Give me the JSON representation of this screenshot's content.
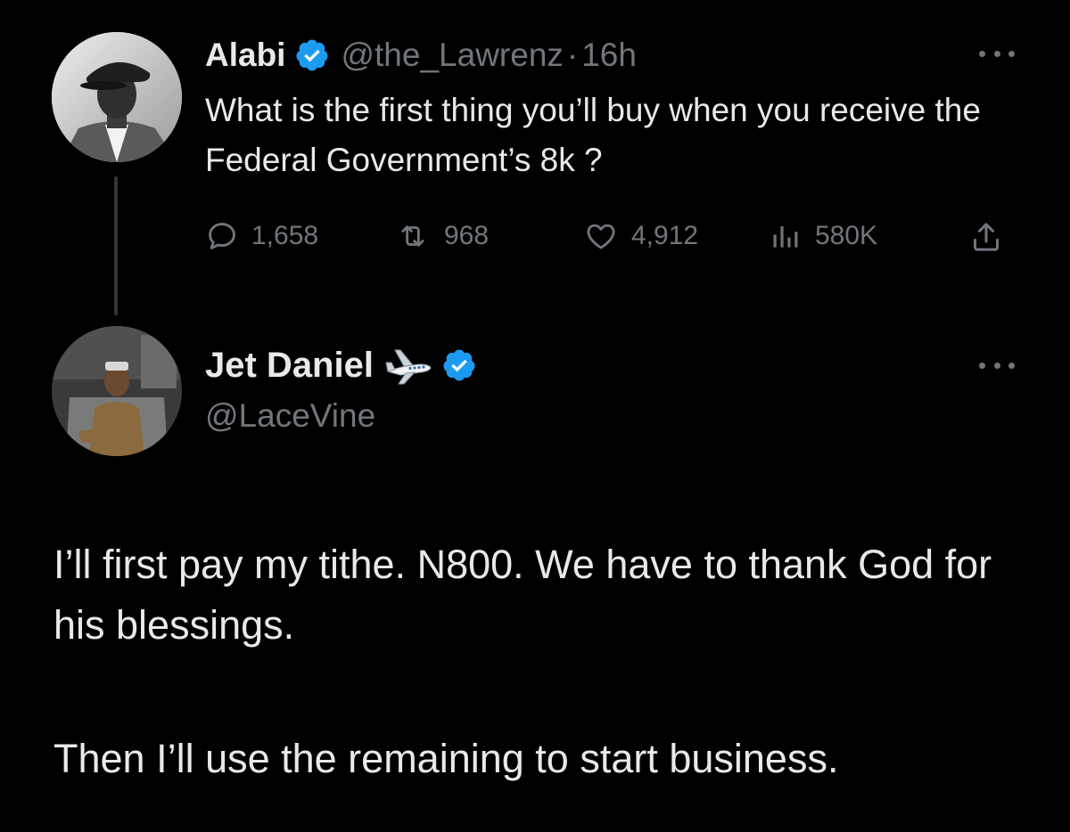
{
  "tweet": {
    "display_name": "Alabi",
    "handle": "@the_Lawrenz",
    "separator": "·",
    "time": "16h",
    "text": "What is the first thing you’ll buy when you receive the Federal Government’s 8k ?",
    "stats": {
      "replies": "1,658",
      "retweets": "968",
      "likes": "4,912",
      "views": "580K"
    }
  },
  "reply": {
    "display_name": "Jet Daniel",
    "handle": "@LaceVine",
    "paragraph_1": "I’ll first pay my tithe. N800. We have to thank God for his blessings.",
    "paragraph_2": "Then I’ll use the remaining to start business."
  },
  "icons": {
    "verified": "verified-badge-icon",
    "more": "more-options-icon",
    "reply": "reply-icon",
    "retweet": "retweet-icon",
    "like": "heart-icon",
    "views": "views-chart-icon",
    "share": "share-icon",
    "airplane": "airplane-emoji-icon"
  },
  "colors": {
    "background": "#000000",
    "text_primary": "#e7e9ea",
    "text_secondary": "#71767b",
    "verified_blue": "#1d9bf0",
    "thread_line": "#333639"
  }
}
